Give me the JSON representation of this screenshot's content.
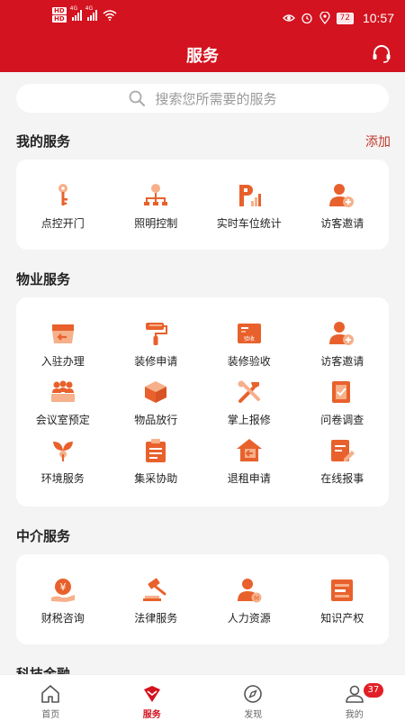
{
  "status_bar": {
    "hd_top": "HD",
    "hd_bottom": "HD",
    "net1": "4G",
    "net2": "4G",
    "battery": "72",
    "time": "10:57"
  },
  "header": {
    "title": "服务"
  },
  "search": {
    "placeholder": "搜索您所需要的服务"
  },
  "my_services": {
    "title": "我的服务",
    "add_label": "添加",
    "items": [
      {
        "label": "点控开门",
        "icon": "key-icon"
      },
      {
        "label": "照明控制",
        "icon": "lighting-control-icon"
      },
      {
        "label": "实时车位统计",
        "icon": "parking-stats-icon"
      },
      {
        "label": "访客邀请",
        "icon": "visitor-invite-icon"
      }
    ]
  },
  "property_services": {
    "title": "物业服务",
    "items": [
      {
        "label": "入驻办理",
        "icon": "move-in-icon"
      },
      {
        "label": "装修申请",
        "icon": "paint-roller-icon"
      },
      {
        "label": "装修验收",
        "icon": "inspection-icon",
        "tag": "验收"
      },
      {
        "label": "访客邀请",
        "icon": "visitor-invite-icon"
      },
      {
        "label": "会议室预定",
        "icon": "meeting-room-icon"
      },
      {
        "label": "物品放行",
        "icon": "package-release-icon"
      },
      {
        "label": "掌上报修",
        "icon": "repair-tools-icon"
      },
      {
        "label": "问卷调查",
        "icon": "survey-icon"
      },
      {
        "label": "环境服务",
        "icon": "plant-icon"
      },
      {
        "label": "集采协助",
        "icon": "clipboard-icon"
      },
      {
        "label": "退租申请",
        "icon": "move-out-icon"
      },
      {
        "label": "在线报事",
        "icon": "report-edit-icon"
      }
    ]
  },
  "agency_services": {
    "title": "中介服务",
    "items": [
      {
        "label": "财税咨询",
        "icon": "finance-tax-icon"
      },
      {
        "label": "法律服务",
        "icon": "gavel-icon"
      },
      {
        "label": "人力资源",
        "icon": "hr-icon"
      },
      {
        "label": "知识产权",
        "icon": "ip-icon"
      }
    ]
  },
  "tech_finance": {
    "title": "科技金融"
  },
  "tabbar": {
    "tabs": [
      {
        "label": "首页",
        "icon": "home-icon"
      },
      {
        "label": "服务",
        "icon": "service-icon"
      },
      {
        "label": "发现",
        "icon": "compass-icon"
      },
      {
        "label": "我的",
        "icon": "profile-icon"
      }
    ],
    "badge": "37"
  },
  "colors": {
    "brand": "#d3131f",
    "icon_orange": "#e8612c",
    "icon_light": "#f6b08a"
  }
}
